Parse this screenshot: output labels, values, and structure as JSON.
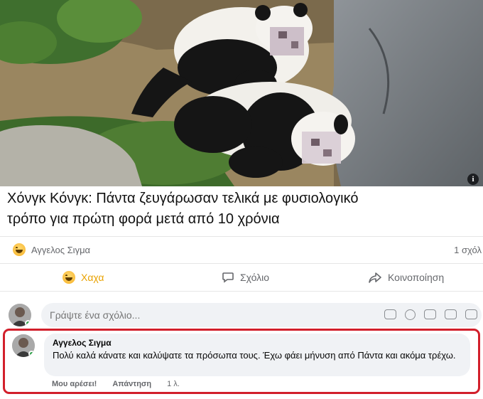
{
  "post": {
    "headline_line1": "Χόνγκ Κόνγκ: Πάντα ζευγάρωσαν τελικά με φυσιολογικό",
    "headline_line2": "τρόπο για πρώτη φορά μετά από 10 χρόνια",
    "info_glyph": "i"
  },
  "reactions": {
    "reactor_name": "Αγγελος Σιγμα",
    "comment_count": "1 σχόλ"
  },
  "actions": {
    "laugh_label": "Χαχα",
    "comment_label": "Σχόλιο",
    "share_label": "Κοινοποίηση"
  },
  "composer": {
    "placeholder": "Γράψτε ένα σχόλιο..."
  },
  "comment": {
    "author": "Αγγελος Σιγμα",
    "text": "Πολύ καλά κάνατε και καλύψατε τα πρόσωπα τους. Έχω φάει μήνυση από Πάντα και ακόμα τρέχω.",
    "like_label": "Μου αρέσει!",
    "reply_label": "Απάντηση",
    "time": "1 λ."
  },
  "colors": {
    "accent_laugh": "#e9a200",
    "highlight_border": "#d21f2b",
    "online_dot": "#31a24c"
  }
}
